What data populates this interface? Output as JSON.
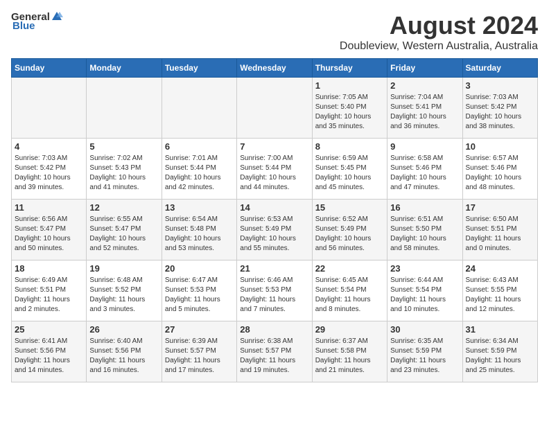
{
  "header": {
    "logo_general": "General",
    "logo_blue": "Blue",
    "main_title": "August 2024",
    "sub_title": "Doubleview, Western Australia, Australia"
  },
  "days_of_week": [
    "Sunday",
    "Monday",
    "Tuesday",
    "Wednesday",
    "Thursday",
    "Friday",
    "Saturday"
  ],
  "weeks": [
    [
      {
        "day": "",
        "info": ""
      },
      {
        "day": "",
        "info": ""
      },
      {
        "day": "",
        "info": ""
      },
      {
        "day": "",
        "info": ""
      },
      {
        "day": "1",
        "info": "Sunrise: 7:05 AM\nSunset: 5:40 PM\nDaylight: 10 hours\nand 35 minutes."
      },
      {
        "day": "2",
        "info": "Sunrise: 7:04 AM\nSunset: 5:41 PM\nDaylight: 10 hours\nand 36 minutes."
      },
      {
        "day": "3",
        "info": "Sunrise: 7:03 AM\nSunset: 5:42 PM\nDaylight: 10 hours\nand 38 minutes."
      }
    ],
    [
      {
        "day": "4",
        "info": "Sunrise: 7:03 AM\nSunset: 5:42 PM\nDaylight: 10 hours\nand 39 minutes."
      },
      {
        "day": "5",
        "info": "Sunrise: 7:02 AM\nSunset: 5:43 PM\nDaylight: 10 hours\nand 41 minutes."
      },
      {
        "day": "6",
        "info": "Sunrise: 7:01 AM\nSunset: 5:44 PM\nDaylight: 10 hours\nand 42 minutes."
      },
      {
        "day": "7",
        "info": "Sunrise: 7:00 AM\nSunset: 5:44 PM\nDaylight: 10 hours\nand 44 minutes."
      },
      {
        "day": "8",
        "info": "Sunrise: 6:59 AM\nSunset: 5:45 PM\nDaylight: 10 hours\nand 45 minutes."
      },
      {
        "day": "9",
        "info": "Sunrise: 6:58 AM\nSunset: 5:46 PM\nDaylight: 10 hours\nand 47 minutes."
      },
      {
        "day": "10",
        "info": "Sunrise: 6:57 AM\nSunset: 5:46 PM\nDaylight: 10 hours\nand 48 minutes."
      }
    ],
    [
      {
        "day": "11",
        "info": "Sunrise: 6:56 AM\nSunset: 5:47 PM\nDaylight: 10 hours\nand 50 minutes."
      },
      {
        "day": "12",
        "info": "Sunrise: 6:55 AM\nSunset: 5:47 PM\nDaylight: 10 hours\nand 52 minutes."
      },
      {
        "day": "13",
        "info": "Sunrise: 6:54 AM\nSunset: 5:48 PM\nDaylight: 10 hours\nand 53 minutes."
      },
      {
        "day": "14",
        "info": "Sunrise: 6:53 AM\nSunset: 5:49 PM\nDaylight: 10 hours\nand 55 minutes."
      },
      {
        "day": "15",
        "info": "Sunrise: 6:52 AM\nSunset: 5:49 PM\nDaylight: 10 hours\nand 56 minutes."
      },
      {
        "day": "16",
        "info": "Sunrise: 6:51 AM\nSunset: 5:50 PM\nDaylight: 10 hours\nand 58 minutes."
      },
      {
        "day": "17",
        "info": "Sunrise: 6:50 AM\nSunset: 5:51 PM\nDaylight: 11 hours\nand 0 minutes."
      }
    ],
    [
      {
        "day": "18",
        "info": "Sunrise: 6:49 AM\nSunset: 5:51 PM\nDaylight: 11 hours\nand 2 minutes."
      },
      {
        "day": "19",
        "info": "Sunrise: 6:48 AM\nSunset: 5:52 PM\nDaylight: 11 hours\nand 3 minutes."
      },
      {
        "day": "20",
        "info": "Sunrise: 6:47 AM\nSunset: 5:53 PM\nDaylight: 11 hours\nand 5 minutes."
      },
      {
        "day": "21",
        "info": "Sunrise: 6:46 AM\nSunset: 5:53 PM\nDaylight: 11 hours\nand 7 minutes."
      },
      {
        "day": "22",
        "info": "Sunrise: 6:45 AM\nSunset: 5:54 PM\nDaylight: 11 hours\nand 8 minutes."
      },
      {
        "day": "23",
        "info": "Sunrise: 6:44 AM\nSunset: 5:54 PM\nDaylight: 11 hours\nand 10 minutes."
      },
      {
        "day": "24",
        "info": "Sunrise: 6:43 AM\nSunset: 5:55 PM\nDaylight: 11 hours\nand 12 minutes."
      }
    ],
    [
      {
        "day": "25",
        "info": "Sunrise: 6:41 AM\nSunset: 5:56 PM\nDaylight: 11 hours\nand 14 minutes."
      },
      {
        "day": "26",
        "info": "Sunrise: 6:40 AM\nSunset: 5:56 PM\nDaylight: 11 hours\nand 16 minutes."
      },
      {
        "day": "27",
        "info": "Sunrise: 6:39 AM\nSunset: 5:57 PM\nDaylight: 11 hours\nand 17 minutes."
      },
      {
        "day": "28",
        "info": "Sunrise: 6:38 AM\nSunset: 5:57 PM\nDaylight: 11 hours\nand 19 minutes."
      },
      {
        "day": "29",
        "info": "Sunrise: 6:37 AM\nSunset: 5:58 PM\nDaylight: 11 hours\nand 21 minutes."
      },
      {
        "day": "30",
        "info": "Sunrise: 6:35 AM\nSunset: 5:59 PM\nDaylight: 11 hours\nand 23 minutes."
      },
      {
        "day": "31",
        "info": "Sunrise: 6:34 AM\nSunset: 5:59 PM\nDaylight: 11 hours\nand 25 minutes."
      }
    ]
  ]
}
